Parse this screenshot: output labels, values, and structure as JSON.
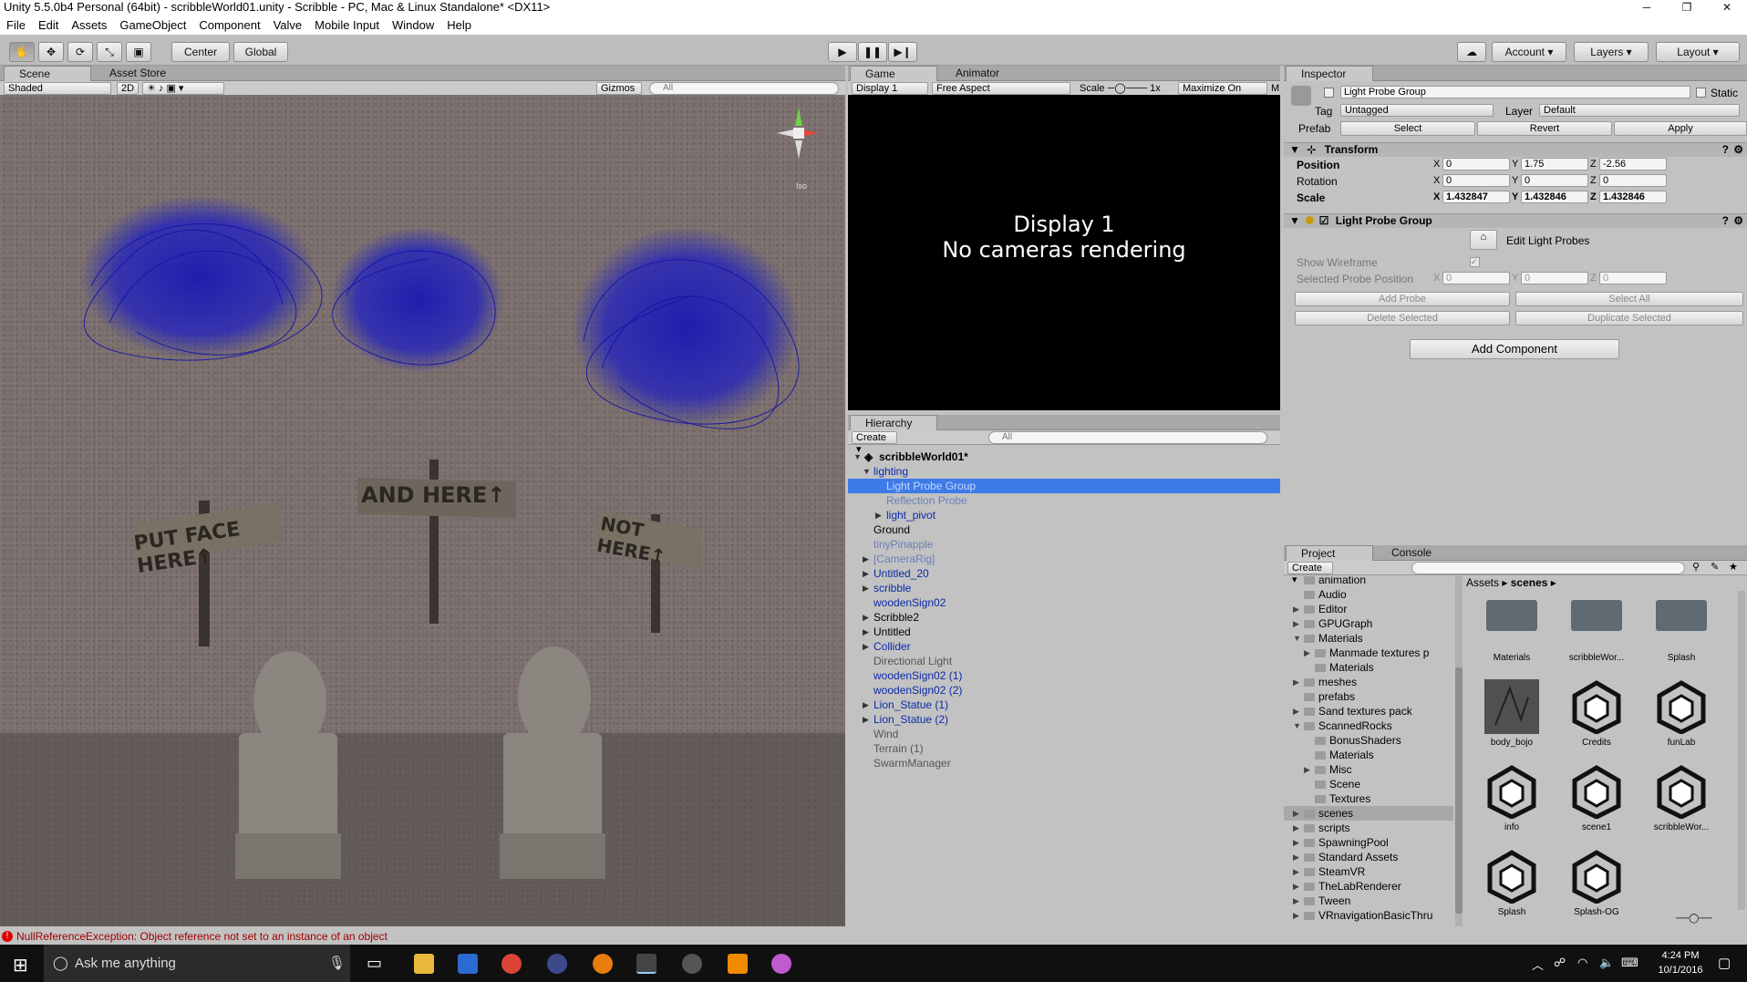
{
  "window": {
    "title": "Unity 5.5.0b4 Personal (64bit) - scribbleWorld01.unity - Scribble - PC, Mac & Linux Standalone* <DX11>"
  },
  "menu": [
    "File",
    "Edit",
    "Assets",
    "GameObject",
    "Component",
    "Valve",
    "Mobile Input",
    "Window",
    "Help"
  ],
  "toolbar": {
    "pivot": "Center",
    "space": "Global",
    "account": "Account",
    "layers": "Layers",
    "layout": "Layout"
  },
  "scene": {
    "tab": "Scene",
    "tab2": "Asset Store",
    "shading": "Shaded",
    "mode2d": "2D",
    "gizmos": "Gizmos",
    "search_placeholder": "All",
    "iso": "Iso",
    "signs": [
      "PUT FACE HERE↑",
      "AND HERE↑",
      "NOT HERE↑"
    ]
  },
  "game": {
    "tab": "Game",
    "tab2": "Animator",
    "display": "Display 1",
    "aspect": "Free Aspect",
    "scale_label": "Scale",
    "scale_value": "1x",
    "maximize": "Maximize On Play",
    "m": "M",
    "line1": "Display 1",
    "line2": "No cameras rendering"
  },
  "hierarchy": {
    "tab": "Hierarchy",
    "create": "Create",
    "search_placeholder": "All",
    "scene_name": "scribbleWorld01*",
    "items": [
      {
        "label": "lighting",
        "indent": 1,
        "expand": "open",
        "color": "#0a2aa8"
      },
      {
        "label": "Light Probe Group",
        "indent": 2,
        "selected": true,
        "color": "#c8d8f5"
      },
      {
        "label": "Reflection Probe",
        "indent": 2,
        "color": "#6b7fb8"
      },
      {
        "label": "light_pivot",
        "indent": 2,
        "expand": "closed",
        "color": "#0a2aa8"
      },
      {
        "label": "Ground",
        "indent": 1,
        "color": "#000"
      },
      {
        "label": "tinyPinapple",
        "indent": 1,
        "color": "#6b7fb8"
      },
      {
        "label": "[CameraRig]",
        "indent": 1,
        "expand": "closed",
        "color": "#6b7fb8"
      },
      {
        "label": "Untitled_20",
        "indent": 1,
        "expand": "closed",
        "color": "#0a2aa8"
      },
      {
        "label": "scribble",
        "indent": 1,
        "expand": "closed",
        "color": "#0a2aa8"
      },
      {
        "label": "woodenSign02",
        "indent": 1,
        "color": "#0a2aa8"
      },
      {
        "label": "Scribble2",
        "indent": 1,
        "expand": "closed",
        "color": "#000"
      },
      {
        "label": "Untitled",
        "indent": 1,
        "expand": "closed",
        "color": "#000"
      },
      {
        "label": "Collider",
        "indent": 1,
        "expand": "closed",
        "color": "#0a2aa8"
      },
      {
        "label": "Directional Light",
        "indent": 1,
        "color": "#555"
      },
      {
        "label": "woodenSign02 (1)",
        "indent": 1,
        "color": "#0a2aa8"
      },
      {
        "label": "woodenSign02 (2)",
        "indent": 1,
        "color": "#0a2aa8"
      },
      {
        "label": "Lion_Statue (1)",
        "indent": 1,
        "expand": "closed",
        "color": "#0a2aa8"
      },
      {
        "label": "Lion_Statue (2)",
        "indent": 1,
        "expand": "closed",
        "color": "#0a2aa8"
      },
      {
        "label": "Wind",
        "indent": 1,
        "color": "#555"
      },
      {
        "label": "Terrain (1)",
        "indent": 1,
        "color": "#555"
      },
      {
        "label": "SwarmManager",
        "indent": 1,
        "color": "#555"
      }
    ]
  },
  "inspector": {
    "tab": "Inspector",
    "object_name": "Light Probe Group",
    "static": "Static",
    "tag_label": "Tag",
    "tag": "Untagged",
    "layer_label": "Layer",
    "layer": "Default",
    "prefab_label": "Prefab",
    "select": "Select",
    "revert": "Revert",
    "apply": "Apply",
    "transform": {
      "title": "Transform",
      "position": "Position",
      "rotation": "Rotation",
      "scale": "Scale",
      "x": "X",
      "y": "Y",
      "z": "Z",
      "pos": [
        "0",
        "1.75",
        "-2.56"
      ],
      "rot": [
        "0",
        "0",
        "0"
      ],
      "scl": [
        "1.432847",
        "1.432846",
        "1.432846"
      ]
    },
    "lpg": {
      "title": "Light Probe Group",
      "edit": "Edit Light Probes",
      "show_wireframe": "Show Wireframe",
      "selected_pos": "Selected Probe Position",
      "sel": [
        "0",
        "0",
        "0"
      ],
      "add_probe": "Add Probe",
      "select_all": "Select All",
      "delete_selected": "Delete Selected",
      "duplicate_selected": "Duplicate Selected"
    },
    "add_component": "Add Component"
  },
  "project": {
    "tab": "Project",
    "tab2": "Console",
    "create": "Create",
    "crumb_root": "Assets",
    "crumb_leaf": "scenes",
    "tree": [
      {
        "label": "animation",
        "indent": 1
      },
      {
        "label": "Audio",
        "indent": 1
      },
      {
        "label": "Editor",
        "indent": 1,
        "expand": "closed"
      },
      {
        "label": "GPUGraph",
        "indent": 1,
        "expand": "closed"
      },
      {
        "label": "Materials",
        "indent": 1,
        "expand": "open"
      },
      {
        "label": "Manmade textures p",
        "indent": 2,
        "expand": "closed"
      },
      {
        "label": "Materials",
        "indent": 2
      },
      {
        "label": "meshes",
        "indent": 1,
        "expand": "closed"
      },
      {
        "label": "prefabs",
        "indent": 1
      },
      {
        "label": "Sand textures pack",
        "indent": 1,
        "expand": "closed"
      },
      {
        "label": "ScannedRocks",
        "indent": 1,
        "expand": "open"
      },
      {
        "label": "BonusShaders",
        "indent": 2
      },
      {
        "label": "Materials",
        "indent": 2
      },
      {
        "label": "Misc",
        "indent": 2,
        "expand": "closed"
      },
      {
        "label": "Scene",
        "indent": 2
      },
      {
        "label": "Textures",
        "indent": 2
      },
      {
        "label": "scenes",
        "indent": 1,
        "expand": "closed",
        "selected": true
      },
      {
        "label": "scripts",
        "indent": 1,
        "expand": "closed"
      },
      {
        "label": "SpawningPool",
        "indent": 1,
        "expand": "closed"
      },
      {
        "label": "Standard Assets",
        "indent": 1,
        "expand": "closed"
      },
      {
        "label": "SteamVR",
        "indent": 1,
        "expand": "closed"
      },
      {
        "label": "TheLabRenderer",
        "indent": 1,
        "expand": "closed"
      },
      {
        "label": "Tween",
        "indent": 1,
        "expand": "closed"
      },
      {
        "label": "VRnavigationBasicThru",
        "indent": 1,
        "expand": "closed"
      }
    ],
    "assets": [
      {
        "label": "Materials",
        "kind": "folder"
      },
      {
        "label": "scribbleWor...",
        "kind": "folder"
      },
      {
        "label": "Splash",
        "kind": "folder"
      },
      {
        "label": "body_bojo",
        "kind": "texture"
      },
      {
        "label": "Credits",
        "kind": "unity"
      },
      {
        "label": "funLab",
        "kind": "unity"
      },
      {
        "label": "info",
        "kind": "unity"
      },
      {
        "label": "scene1",
        "kind": "unity"
      },
      {
        "label": "scribbleWor...",
        "kind": "unity"
      },
      {
        "label": "Splash",
        "kind": "unity"
      },
      {
        "label": "Splash-OG",
        "kind": "unity"
      }
    ]
  },
  "status": {
    "message": "NullReferenceException: Object reference not set to an instance of an object"
  },
  "taskbar": {
    "search": "Ask me anything",
    "time": "4:24 PM",
    "date": "10/1/2016"
  }
}
